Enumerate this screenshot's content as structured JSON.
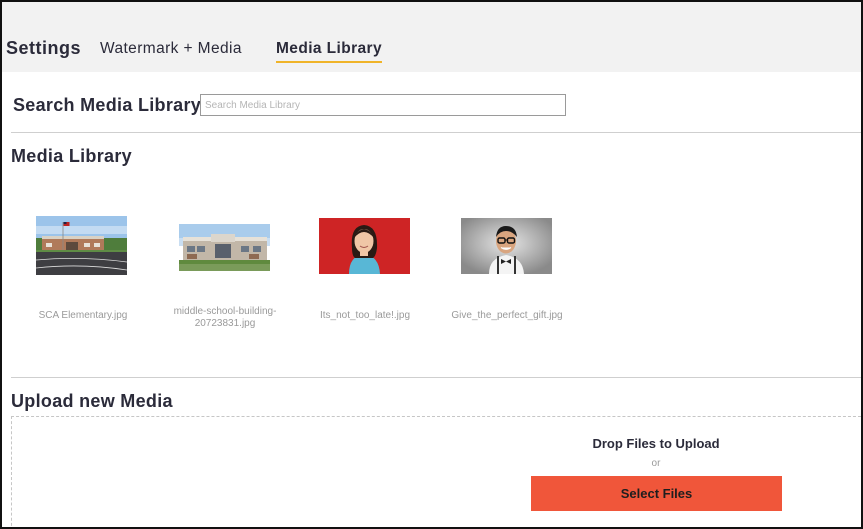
{
  "header": {
    "title": "Settings",
    "tabs": [
      {
        "label": "Watermark + Media",
        "active": false
      },
      {
        "label": "Media Library",
        "active": true
      }
    ],
    "active_tab_underline_color": "#f0b429"
  },
  "search": {
    "label": "Search Media Library",
    "placeholder": "Search Media Library",
    "value": ""
  },
  "library": {
    "title": "Media Library",
    "items": [
      {
        "filename": "SCA Elementary.jpg",
        "thumbnail": "school-building-flag-photo"
      },
      {
        "filename": "middle-school-building-20723831.jpg",
        "thumbnail": "middle-school-building-photo"
      },
      {
        "filename": "Its_not_too_late!.jpg",
        "thumbnail": "girl-portrait-red-background-photo"
      },
      {
        "filename": "Give_the_perfect_gift.jpg",
        "thumbnail": "boy-glasses-bowtie-portrait-photo"
      }
    ]
  },
  "upload": {
    "title": "Upload new Media",
    "drop_text": "Drop Files to Upload",
    "or_text": "or",
    "button_label": "Select Files",
    "button_color": "#f0563a"
  }
}
